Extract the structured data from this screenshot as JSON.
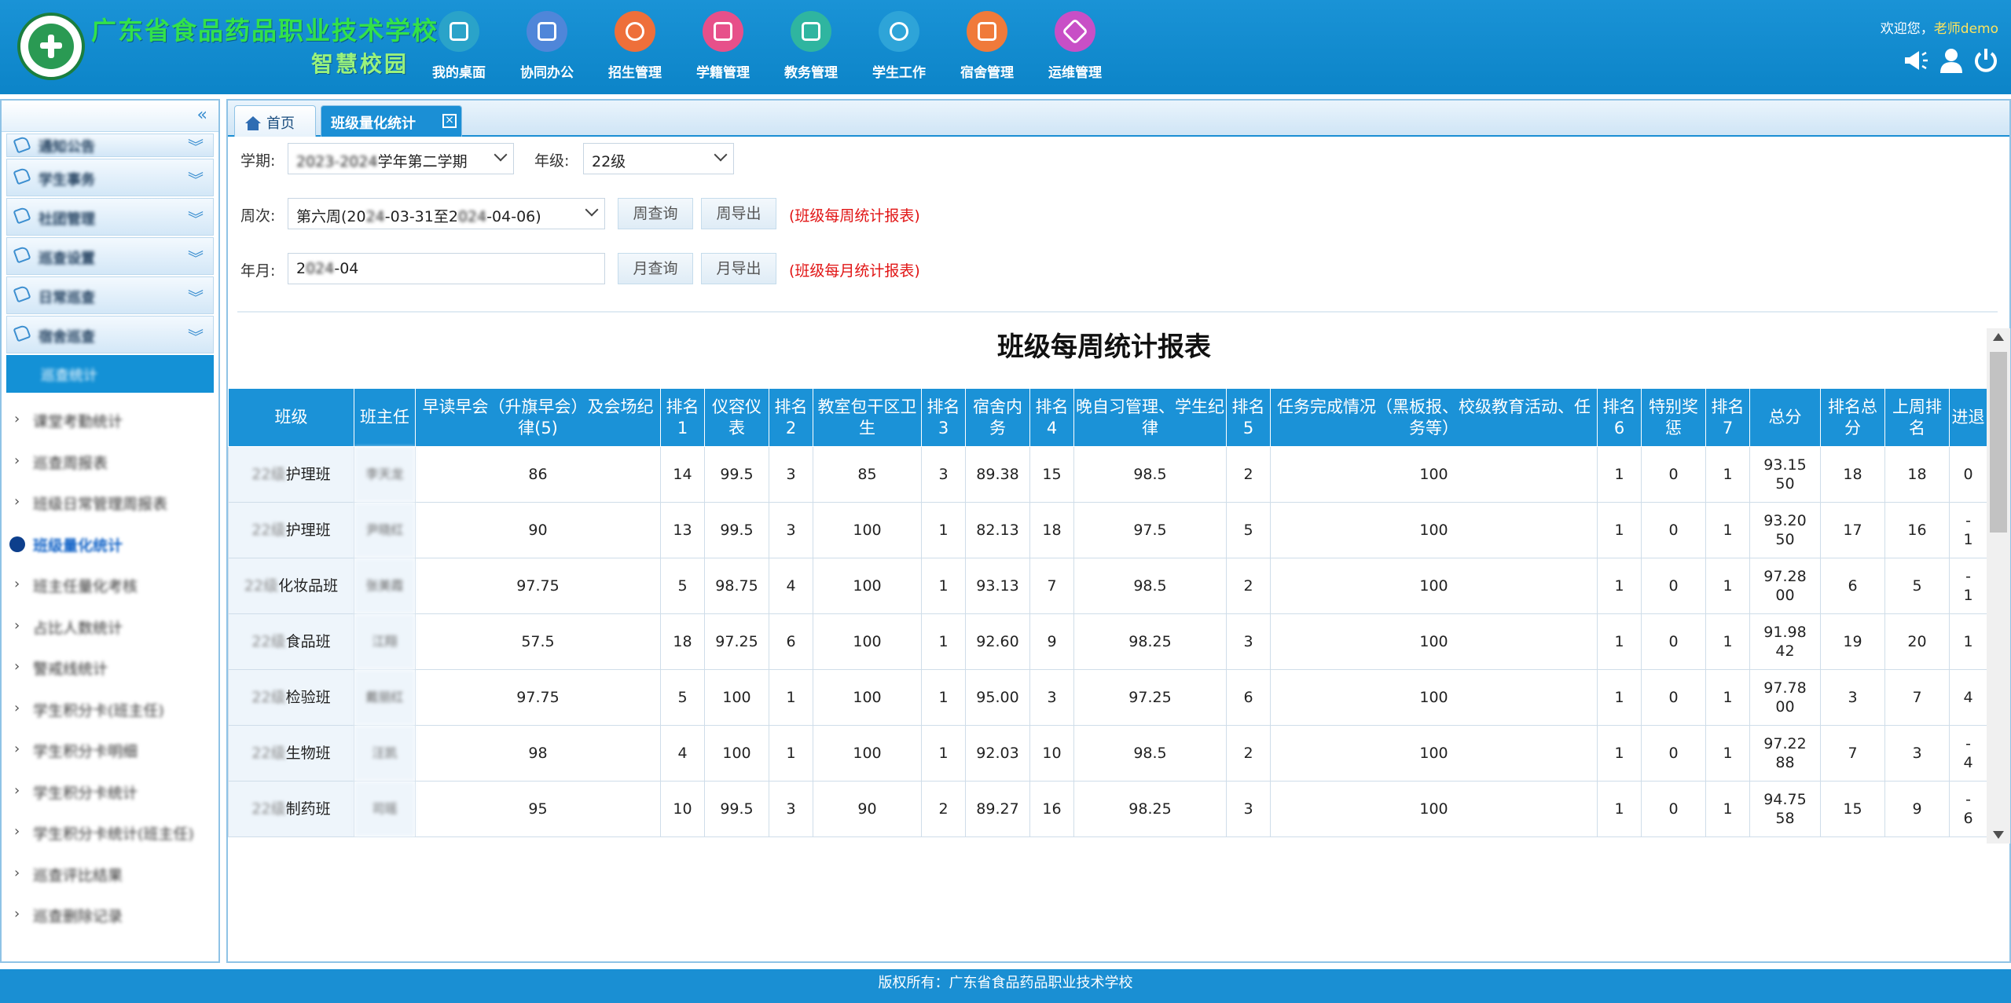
{
  "header": {
    "school_name": "广东省食品药品职业技术学校",
    "campus_name": "智慧校园",
    "nav": [
      {
        "label": "我的桌面",
        "icon": "desktop-icon",
        "color": "#2aa3c9"
      },
      {
        "label": "协同办公",
        "icon": "office-icon",
        "color": "#4f86d9"
      },
      {
        "label": "招生管理",
        "icon": "enrollment-icon",
        "color": "#ee6f3a"
      },
      {
        "label": "学籍管理",
        "icon": "student-records-icon",
        "color": "#e7508a"
      },
      {
        "label": "教务管理",
        "icon": "academic-icon",
        "color": "#2fb5a0"
      },
      {
        "label": "学生工作",
        "icon": "student-work-icon",
        "color": "#2ea4d8"
      },
      {
        "label": "宿舍管理",
        "icon": "dormitory-icon",
        "color": "#f07a3a"
      },
      {
        "label": "运维管理",
        "icon": "maintenance-icon",
        "color": "#c84fc6"
      }
    ],
    "welcome_prefix": "欢迎您，",
    "user": "老师demo"
  },
  "sidebar": {
    "collapse_glyph": "«",
    "groups": [
      "通知公告",
      "学生事务",
      "社团管理",
      "巡查设置",
      "日常巡查",
      "宿舍巡查"
    ],
    "active_group_item": "巡查统计",
    "items": [
      "课堂考勤统计",
      "巡查周报表",
      "班级日常管理周报表",
      "班级量化统计",
      "班主任量化考核",
      "占比人数统计",
      "警戒线统计",
      "学生积分卡(班主任)",
      "学生积分卡明细",
      "学生积分卡统计",
      "学生积分卡统计(班主任)",
      "巡查评比结果",
      "巡查删除记录"
    ],
    "current_index": 3
  },
  "tabs": {
    "home": "首页",
    "current": "班级量化统计"
  },
  "filters": {
    "term_label": "学期:",
    "term_value_hidden": "2023-2024",
    "term_value": "学年第二学期",
    "grade_label": "年级:",
    "grade_value": "22级",
    "week_label": "周次:",
    "week_prefix": "第六周(20",
    "week_mid_hidden": "24",
    "week_mid": "-03-31至2",
    "week_end_hidden": "024",
    "week_suffix": "-04-06)",
    "week_query": "周查询",
    "week_export": "周导出",
    "week_note": "(班级每周统计报表)",
    "month_label": "年月:",
    "month_hidden_prefix": "2",
    "month_hidden": "024",
    "month_value": "-04",
    "month_query": "月查询",
    "month_export": "月导出",
    "month_note": "(班级每月统计报表)"
  },
  "report": {
    "title": "班级每周统计报表",
    "columns": [
      "班级",
      "班主任",
      "早读早会（升旗早会）及会场纪律(5)",
      "排名1",
      "仪容仪表",
      "排名2",
      "教室包干区卫生",
      "排名3",
      "宿舍内务",
      "排名4",
      "晚自习管理、学生纪律",
      "排名5",
      "任务完成情况（黑板报、校级教育活动、任务等）",
      "排名6",
      "特别奖惩",
      "排名7",
      "总分",
      "排名总分",
      "上周排名",
      "进退"
    ],
    "rows": [
      {
        "class_hidden": "22级",
        "class": "护理班",
        "teacher": "李天龙",
        "c1": "86",
        "r1": "14",
        "c2": "99.5",
        "r2": "3",
        "c3": "85",
        "r3": "3",
        "c4": "89.38",
        "r4": "15",
        "c5": "98.5",
        "r5": "2",
        "c6": "100",
        "r6": "1",
        "c7": "0",
        "r7": "1",
        "total": "93.1550",
        "rank": "18",
        "last": "18",
        "change": "0"
      },
      {
        "class_hidden": "22级",
        "class": "护理班",
        "teacher": "尹晓红",
        "c1": "90",
        "r1": "13",
        "c2": "99.5",
        "r2": "3",
        "c3": "100",
        "r3": "1",
        "c4": "82.13",
        "r4": "18",
        "c5": "97.5",
        "r5": "5",
        "c6": "100",
        "r6": "1",
        "c7": "0",
        "r7": "1",
        "total": "93.2050",
        "rank": "17",
        "last": "16",
        "change": "-1"
      },
      {
        "class_hidden": "22级",
        "class": "化妆品班",
        "teacher": "张美霞",
        "c1": "97.75",
        "r1": "5",
        "c2": "98.75",
        "r2": "4",
        "c3": "100",
        "r3": "1",
        "c4": "93.13",
        "r4": "7",
        "c5": "98.5",
        "r5": "2",
        "c6": "100",
        "r6": "1",
        "c7": "0",
        "r7": "1",
        "total": "97.2800",
        "rank": "6",
        "last": "5",
        "change": "-1"
      },
      {
        "class_hidden": "22级",
        "class": "食品班",
        "teacher": "江翔",
        "c1": "57.5",
        "r1": "18",
        "c2": "97.25",
        "r2": "6",
        "c3": "100",
        "r3": "1",
        "c4": "92.60",
        "r4": "9",
        "c5": "98.25",
        "r5": "3",
        "c6": "100",
        "r6": "1",
        "c7": "0",
        "r7": "1",
        "total": "91.9842",
        "rank": "19",
        "last": "20",
        "change": "1"
      },
      {
        "class_hidden": "22级",
        "class": "检验班",
        "teacher": "戴丽红",
        "c1": "97.75",
        "r1": "5",
        "c2": "100",
        "r2": "1",
        "c3": "100",
        "r3": "1",
        "c4": "95.00",
        "r4": "3",
        "c5": "97.25",
        "r5": "6",
        "c6": "100",
        "r6": "1",
        "c7": "0",
        "r7": "1",
        "total": "97.7800",
        "rank": "3",
        "last": "7",
        "change": "4"
      },
      {
        "class_hidden": "22级",
        "class": "生物班",
        "teacher": "汪凯",
        "c1": "98",
        "r1": "4",
        "c2": "100",
        "r2": "1",
        "c3": "100",
        "r3": "1",
        "c4": "92.03",
        "r4": "10",
        "c5": "98.5",
        "r5": "2",
        "c6": "100",
        "r6": "1",
        "c7": "0",
        "r7": "1",
        "total": "97.2288",
        "rank": "7",
        "last": "3",
        "change": "-4"
      },
      {
        "class_hidden": "22级",
        "class": "制药班",
        "teacher": "司瑶",
        "c1": "95",
        "r1": "10",
        "c2": "99.5",
        "r2": "3",
        "c3": "90",
        "r3": "2",
        "c4": "89.27",
        "r4": "16",
        "c5": "98.25",
        "r5": "3",
        "c6": "100",
        "r6": "1",
        "c7": "0",
        "r7": "1",
        "total": "94.7558",
        "rank": "15",
        "last": "9",
        "change": "-6"
      }
    ]
  },
  "footer": "版权所有：广东省食品药品职业技术学校",
  "colors": {
    "header": "#0c84c8",
    "accent": "#1b92d7",
    "note_red": "#e11414",
    "user_yellow": "#ffe45c"
  }
}
